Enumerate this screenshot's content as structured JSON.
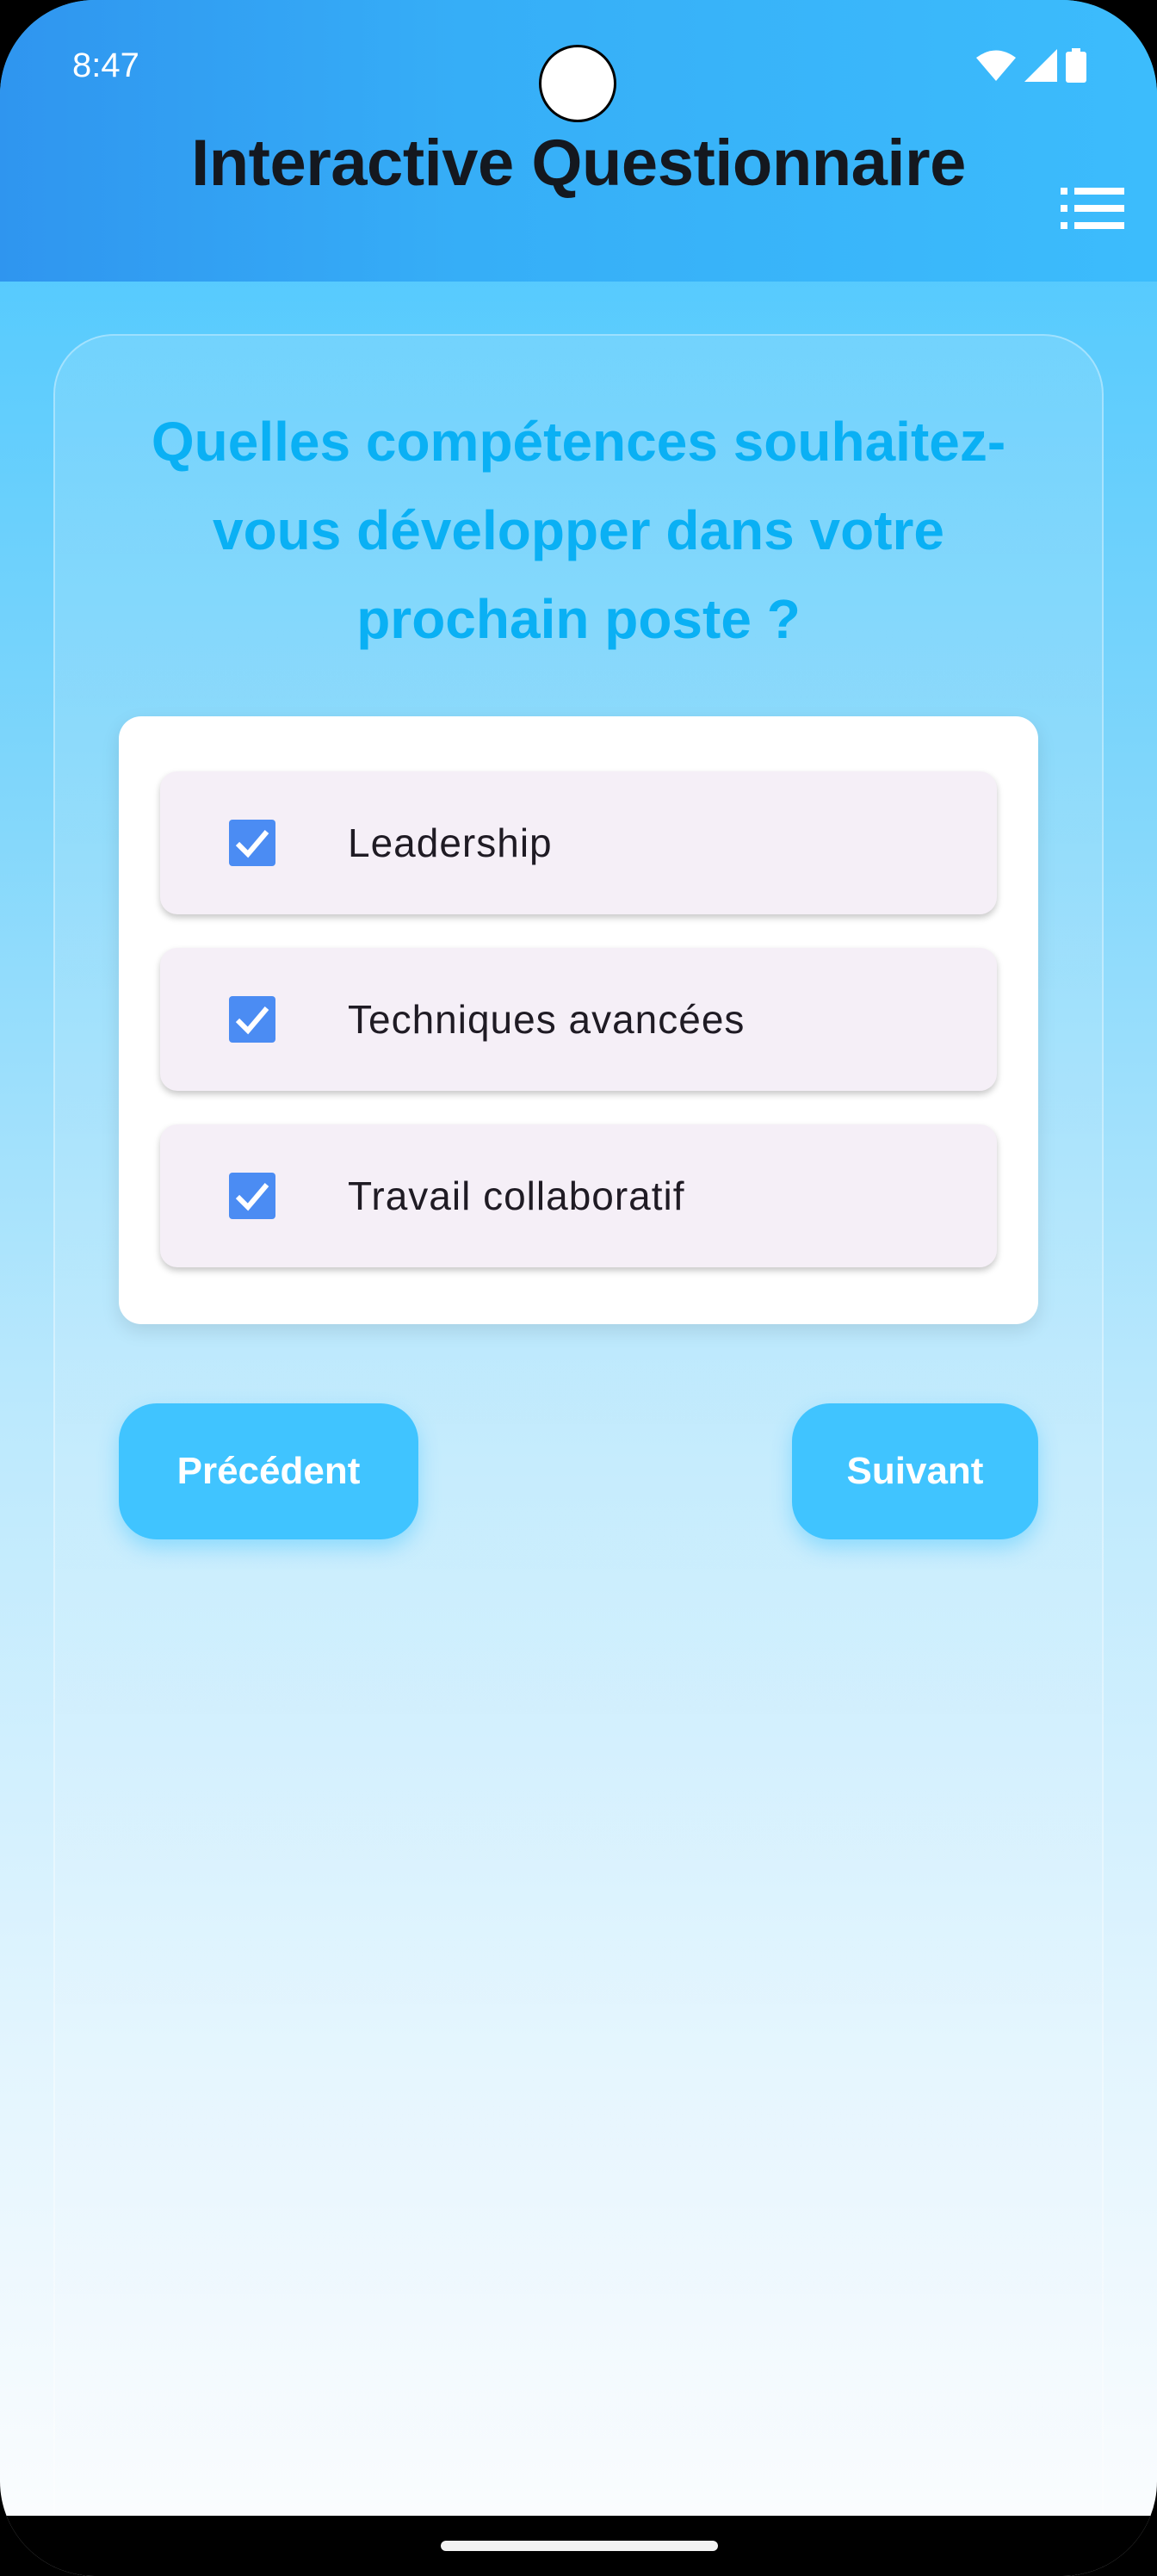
{
  "status_bar": {
    "time": "8:47",
    "icons": [
      "wifi-icon",
      "signal-icon",
      "battery-icon"
    ]
  },
  "app_bar": {
    "title": "Interactive Questionnaire",
    "menu_icon": "list-icon"
  },
  "question": {
    "text": "Quelles compétences souhaitez-vous développer dans votre prochain poste ?"
  },
  "options": [
    {
      "label": "Leadership",
      "checked": true
    },
    {
      "label": "Techniques avancées",
      "checked": true
    },
    {
      "label": "Travail collaboratif",
      "checked": true
    }
  ],
  "navigation": {
    "previous_label": "Précédent",
    "next_label": "Suivant"
  },
  "colors": {
    "accent": "#40c4ff",
    "question_text": "#0ab0f4",
    "checkbox": "#4b8cf3",
    "option_bg": "#f5eff7"
  }
}
